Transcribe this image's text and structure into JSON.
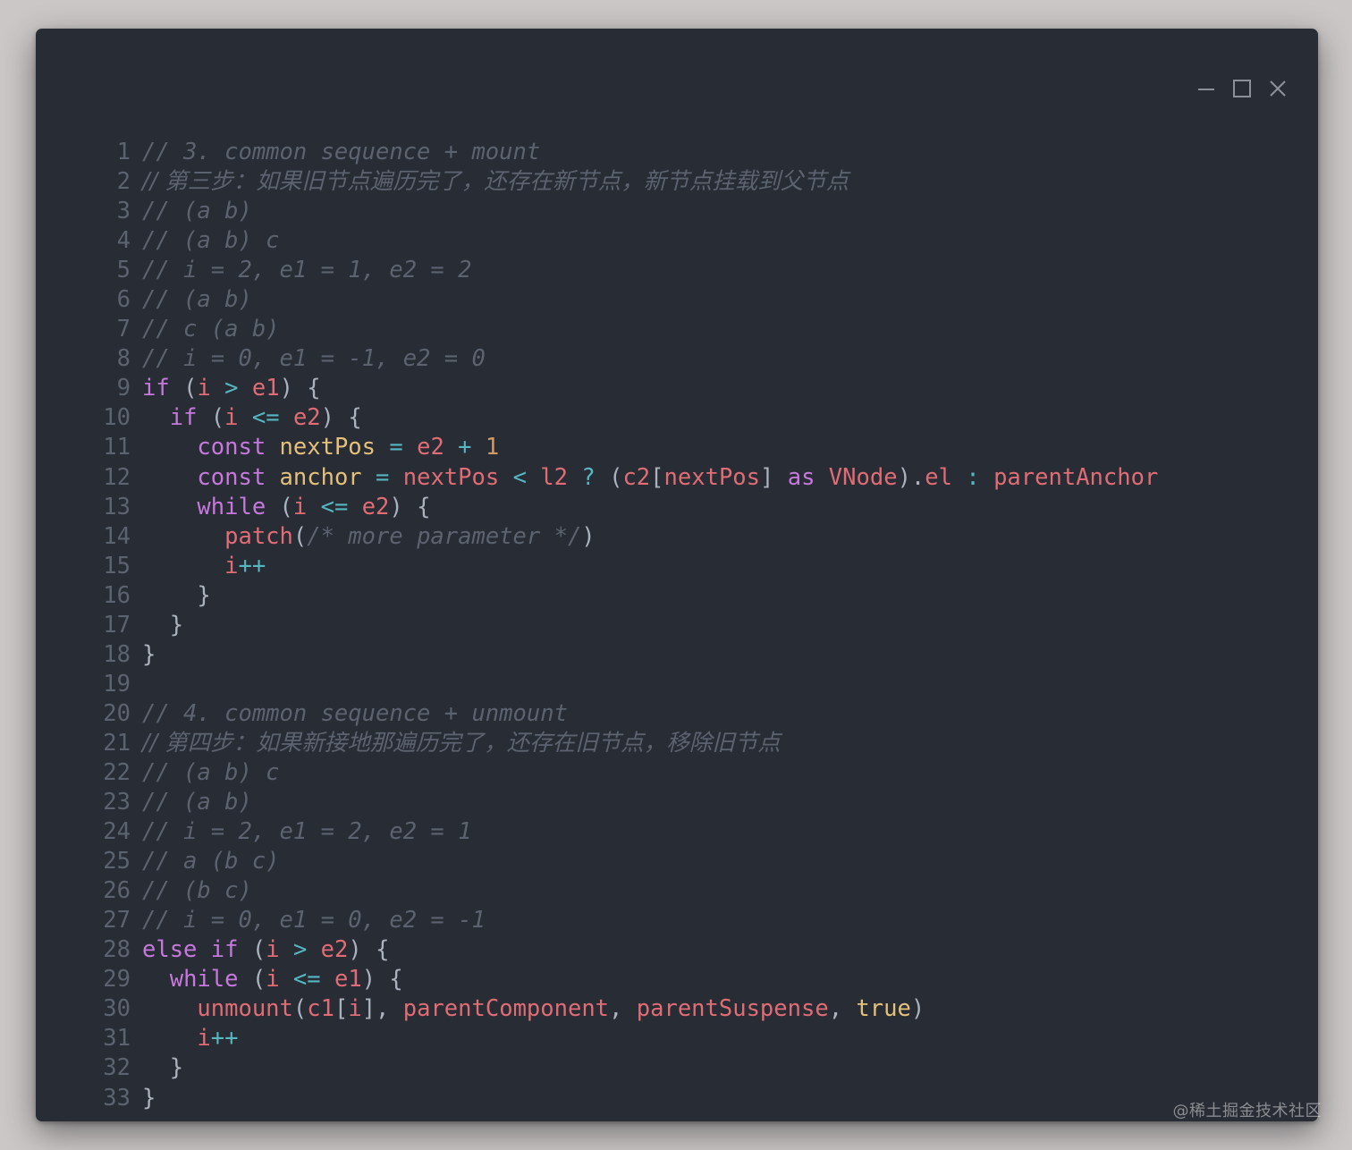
{
  "window": {
    "controls": {
      "minimize_icon": "minimize-icon",
      "maximize_icon": "maximize-icon",
      "close_icon": "close-icon"
    }
  },
  "code": {
    "lines": [
      {
        "n": "1",
        "tokens": [
          {
            "t": "comment",
            "v": "// 3. common sequence + mount"
          }
        ]
      },
      {
        "n": "2",
        "tokens": [
          {
            "t": "comment",
            "v": "// 第三步：如果旧节点遍历完了，还存在新节点，新节点挂载到父节点"
          }
        ]
      },
      {
        "n": "3",
        "tokens": [
          {
            "t": "comment",
            "v": "// (a b)"
          }
        ]
      },
      {
        "n": "4",
        "tokens": [
          {
            "t": "comment",
            "v": "// (a b) c"
          }
        ]
      },
      {
        "n": "5",
        "tokens": [
          {
            "t": "comment",
            "v": "// i = 2, e1 = 1, e2 = 2"
          }
        ]
      },
      {
        "n": "6",
        "tokens": [
          {
            "t": "comment",
            "v": "// (a b)"
          }
        ]
      },
      {
        "n": "7",
        "tokens": [
          {
            "t": "comment",
            "v": "// c (a b)"
          }
        ]
      },
      {
        "n": "8",
        "tokens": [
          {
            "t": "comment",
            "v": "// i = 0, e1 = -1, e2 = 0"
          }
        ]
      },
      {
        "n": "9",
        "tokens": [
          {
            "t": "keyword",
            "v": "if"
          },
          {
            "t": "plain",
            "v": " ("
          },
          {
            "t": "ident",
            "v": "i"
          },
          {
            "t": "plain",
            "v": " "
          },
          {
            "t": "op",
            "v": ">"
          },
          {
            "t": "plain",
            "v": " "
          },
          {
            "t": "ident",
            "v": "e1"
          },
          {
            "t": "plain",
            "v": ") {"
          }
        ]
      },
      {
        "n": "10",
        "tokens": [
          {
            "t": "plain",
            "v": "  "
          },
          {
            "t": "keyword",
            "v": "if"
          },
          {
            "t": "plain",
            "v": " ("
          },
          {
            "t": "ident",
            "v": "i"
          },
          {
            "t": "plain",
            "v": " "
          },
          {
            "t": "op",
            "v": "<="
          },
          {
            "t": "plain",
            "v": " "
          },
          {
            "t": "ident",
            "v": "e2"
          },
          {
            "t": "plain",
            "v": ") {"
          }
        ]
      },
      {
        "n": "11",
        "tokens": [
          {
            "t": "plain",
            "v": "    "
          },
          {
            "t": "keyword",
            "v": "const"
          },
          {
            "t": "plain",
            "v": " "
          },
          {
            "t": "const",
            "v": "nextPos"
          },
          {
            "t": "plain",
            "v": " "
          },
          {
            "t": "op",
            "v": "="
          },
          {
            "t": "plain",
            "v": " "
          },
          {
            "t": "ident",
            "v": "e2"
          },
          {
            "t": "plain",
            "v": " "
          },
          {
            "t": "op",
            "v": "+"
          },
          {
            "t": "plain",
            "v": " "
          },
          {
            "t": "num",
            "v": "1"
          }
        ]
      },
      {
        "n": "12",
        "tokens": [
          {
            "t": "plain",
            "v": "    "
          },
          {
            "t": "keyword",
            "v": "const"
          },
          {
            "t": "plain",
            "v": " "
          },
          {
            "t": "const",
            "v": "anchor"
          },
          {
            "t": "plain",
            "v": " "
          },
          {
            "t": "op",
            "v": "="
          },
          {
            "t": "plain",
            "v": " "
          },
          {
            "t": "ident",
            "v": "nextPos"
          },
          {
            "t": "plain",
            "v": " "
          },
          {
            "t": "op",
            "v": "<"
          },
          {
            "t": "plain",
            "v": " "
          },
          {
            "t": "ident",
            "v": "l2"
          },
          {
            "t": "plain",
            "v": " "
          },
          {
            "t": "op",
            "v": "?"
          },
          {
            "t": "plain",
            "v": " ("
          },
          {
            "t": "ident",
            "v": "c2"
          },
          {
            "t": "plain",
            "v": "["
          },
          {
            "t": "ident",
            "v": "nextPos"
          },
          {
            "t": "plain",
            "v": "] "
          },
          {
            "t": "keyword",
            "v": "as"
          },
          {
            "t": "plain",
            "v": " "
          },
          {
            "t": "ident",
            "v": "VNode"
          },
          {
            "t": "plain",
            "v": ")."
          },
          {
            "t": "ident",
            "v": "el"
          },
          {
            "t": "plain",
            "v": " "
          },
          {
            "t": "op",
            "v": ":"
          },
          {
            "t": "plain",
            "v": " "
          },
          {
            "t": "ident",
            "v": "parentAnchor"
          }
        ]
      },
      {
        "n": "13",
        "tokens": [
          {
            "t": "plain",
            "v": "    "
          },
          {
            "t": "keyword",
            "v": "while"
          },
          {
            "t": "plain",
            "v": " ("
          },
          {
            "t": "ident",
            "v": "i"
          },
          {
            "t": "plain",
            "v": " "
          },
          {
            "t": "op",
            "v": "<="
          },
          {
            "t": "plain",
            "v": " "
          },
          {
            "t": "ident",
            "v": "e2"
          },
          {
            "t": "plain",
            "v": ") {"
          }
        ]
      },
      {
        "n": "14",
        "tokens": [
          {
            "t": "plain",
            "v": "      "
          },
          {
            "t": "ident",
            "v": "patch"
          },
          {
            "t": "plain",
            "v": "("
          },
          {
            "t": "comment",
            "v": "/* more parameter */"
          },
          {
            "t": "plain",
            "v": ")"
          }
        ]
      },
      {
        "n": "15",
        "tokens": [
          {
            "t": "plain",
            "v": "      "
          },
          {
            "t": "ident",
            "v": "i"
          },
          {
            "t": "op",
            "v": "++"
          }
        ]
      },
      {
        "n": "16",
        "tokens": [
          {
            "t": "plain",
            "v": "    }"
          }
        ]
      },
      {
        "n": "17",
        "tokens": [
          {
            "t": "plain",
            "v": "  }"
          }
        ]
      },
      {
        "n": "18",
        "tokens": [
          {
            "t": "plain",
            "v": "}"
          }
        ]
      },
      {
        "n": "19",
        "tokens": []
      },
      {
        "n": "20",
        "tokens": [
          {
            "t": "comment",
            "v": "// 4. common sequence + unmount"
          }
        ]
      },
      {
        "n": "21",
        "tokens": [
          {
            "t": "comment",
            "v": "// 第四步：如果新接地那遍历完了，还存在旧节点，移除旧节点"
          }
        ]
      },
      {
        "n": "22",
        "tokens": [
          {
            "t": "comment",
            "v": "// (a b) c"
          }
        ]
      },
      {
        "n": "23",
        "tokens": [
          {
            "t": "comment",
            "v": "// (a b)"
          }
        ]
      },
      {
        "n": "24",
        "tokens": [
          {
            "t": "comment",
            "v": "// i = 2, e1 = 2, e2 = 1"
          }
        ]
      },
      {
        "n": "25",
        "tokens": [
          {
            "t": "comment",
            "v": "// a (b c)"
          }
        ]
      },
      {
        "n": "26",
        "tokens": [
          {
            "t": "comment",
            "v": "// (b c)"
          }
        ]
      },
      {
        "n": "27",
        "tokens": [
          {
            "t": "comment",
            "v": "// i = 0, e1 = 0, e2 = -1"
          }
        ]
      },
      {
        "n": "28",
        "tokens": [
          {
            "t": "keyword",
            "v": "else"
          },
          {
            "t": "plain",
            "v": " "
          },
          {
            "t": "keyword",
            "v": "if"
          },
          {
            "t": "plain",
            "v": " ("
          },
          {
            "t": "ident",
            "v": "i"
          },
          {
            "t": "plain",
            "v": " "
          },
          {
            "t": "op",
            "v": ">"
          },
          {
            "t": "plain",
            "v": " "
          },
          {
            "t": "ident",
            "v": "e2"
          },
          {
            "t": "plain",
            "v": ") {"
          }
        ]
      },
      {
        "n": "29",
        "tokens": [
          {
            "t": "plain",
            "v": "  "
          },
          {
            "t": "keyword",
            "v": "while"
          },
          {
            "t": "plain",
            "v": " ("
          },
          {
            "t": "ident",
            "v": "i"
          },
          {
            "t": "plain",
            "v": " "
          },
          {
            "t": "op",
            "v": "<="
          },
          {
            "t": "plain",
            "v": " "
          },
          {
            "t": "ident",
            "v": "e1"
          },
          {
            "t": "plain",
            "v": ") {"
          }
        ]
      },
      {
        "n": "30",
        "tokens": [
          {
            "t": "plain",
            "v": "    "
          },
          {
            "t": "ident",
            "v": "unmount"
          },
          {
            "t": "plain",
            "v": "("
          },
          {
            "t": "ident",
            "v": "c1"
          },
          {
            "t": "plain",
            "v": "["
          },
          {
            "t": "ident",
            "v": "i"
          },
          {
            "t": "plain",
            "v": "], "
          },
          {
            "t": "ident",
            "v": "parentComponent"
          },
          {
            "t": "plain",
            "v": ", "
          },
          {
            "t": "ident",
            "v": "parentSuspense"
          },
          {
            "t": "plain",
            "v": ", "
          },
          {
            "t": "bool",
            "v": "true"
          },
          {
            "t": "plain",
            "v": ")"
          }
        ]
      },
      {
        "n": "31",
        "tokens": [
          {
            "t": "plain",
            "v": "    "
          },
          {
            "t": "ident",
            "v": "i"
          },
          {
            "t": "op",
            "v": "++"
          }
        ]
      },
      {
        "n": "32",
        "tokens": [
          {
            "t": "plain",
            "v": "  }"
          }
        ]
      },
      {
        "n": "33",
        "tokens": [
          {
            "t": "plain",
            "v": "}"
          }
        ]
      }
    ]
  },
  "watermark": {
    "text": "@稀土掘金技术社区"
  },
  "colors": {
    "page_bg": "#cbc7c7",
    "editor_bg": "#282c34",
    "line_number": "#5c6370",
    "comment": "#5c6370",
    "keyword": "#c678dd",
    "identifier": "#e06c75",
    "declaration": "#e5c07b",
    "operator": "#56b6c2",
    "number": "#d19a66",
    "plain": "#abb2bf"
  }
}
